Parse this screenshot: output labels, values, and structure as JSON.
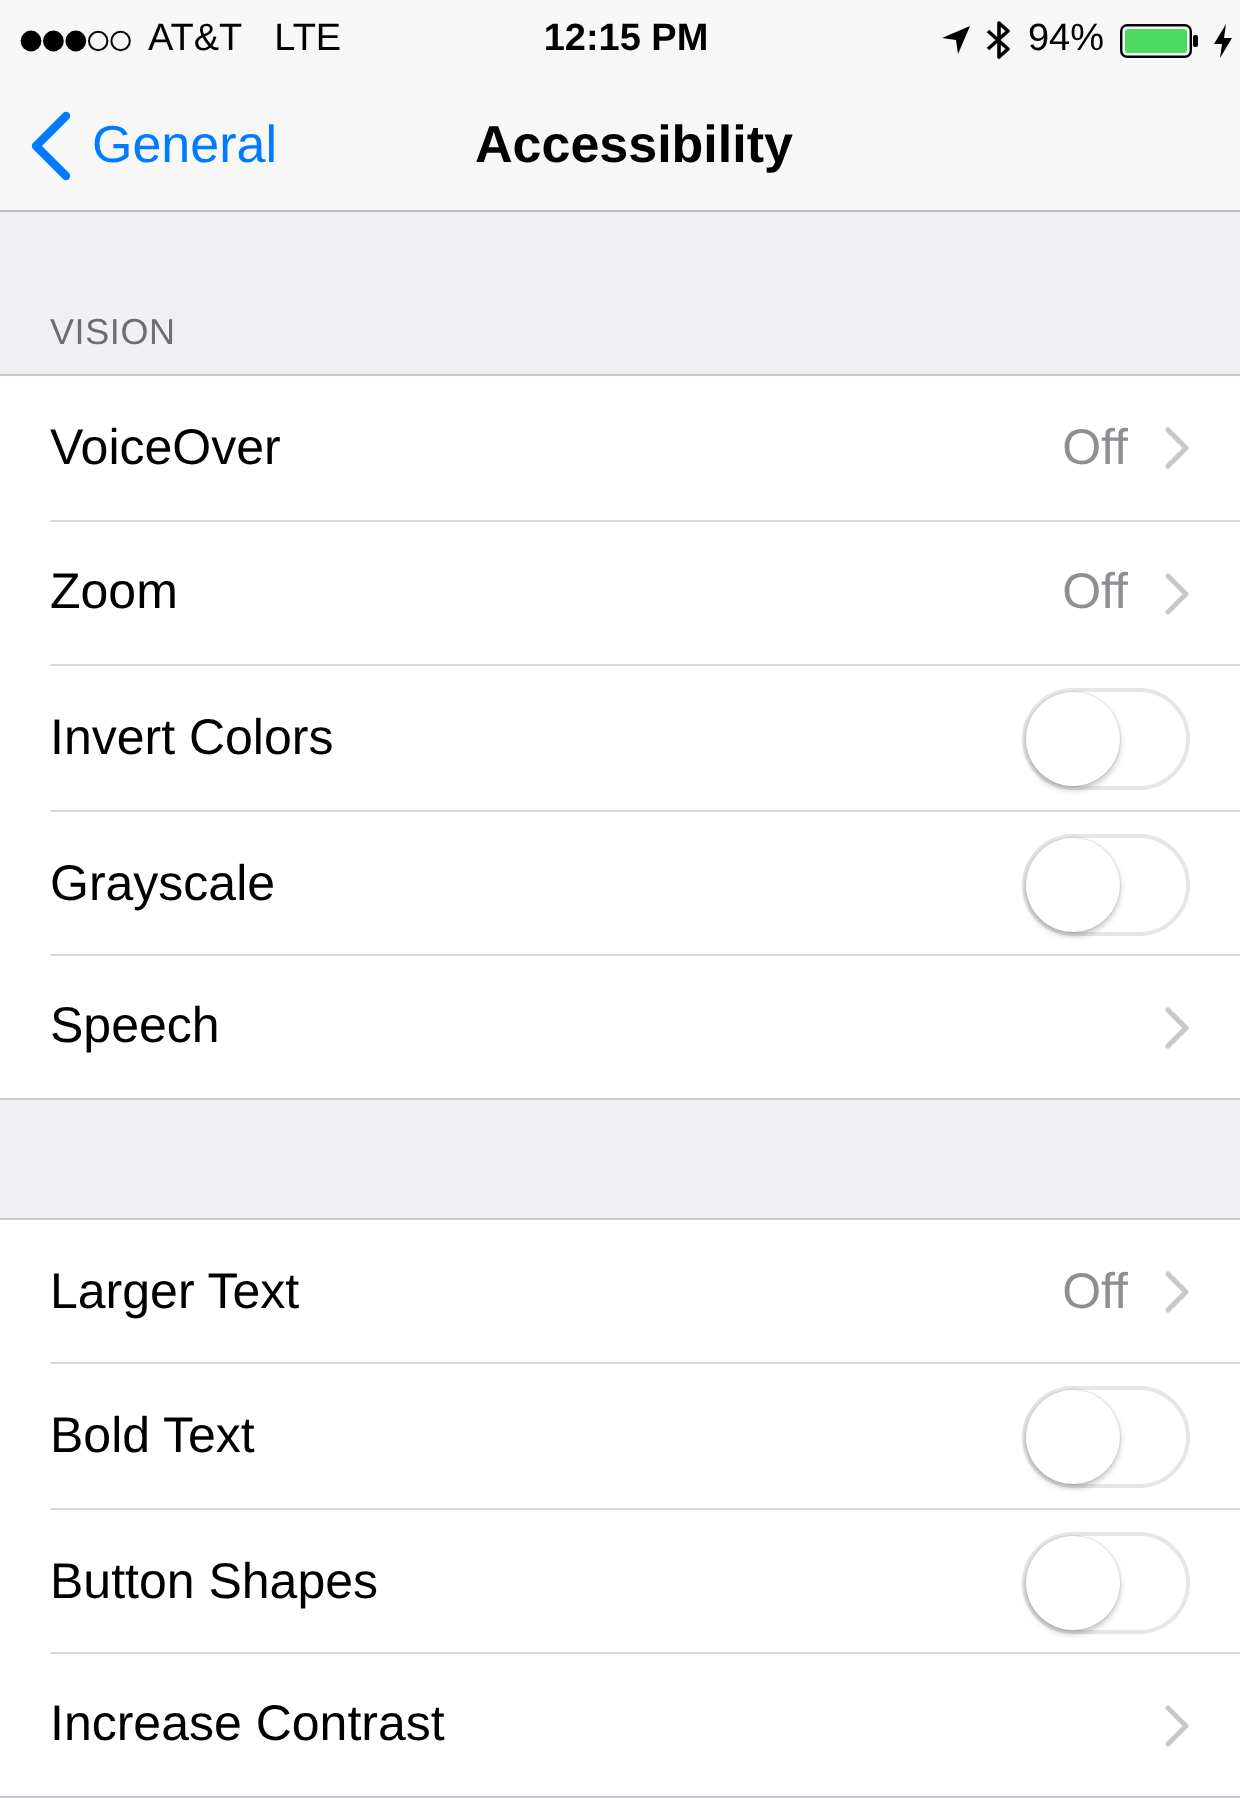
{
  "status_bar": {
    "carrier": "AT&T",
    "network": "LTE",
    "time": "12:15 PM",
    "battery_percent": "94%",
    "charging": true
  },
  "nav_bar": {
    "back_label": "General",
    "title": "Accessibility"
  },
  "sections": [
    {
      "header": "VISION",
      "rows": [
        {
          "kind": "link",
          "label": "VoiceOver",
          "value": "Off"
        },
        {
          "kind": "link",
          "label": "Zoom",
          "value": "Off"
        },
        {
          "kind": "toggle",
          "label": "Invert Colors",
          "on": false
        },
        {
          "kind": "toggle",
          "label": "Grayscale",
          "on": false
        },
        {
          "kind": "link",
          "label": "Speech"
        }
      ]
    },
    {
      "rows": [
        {
          "kind": "link",
          "label": "Larger Text",
          "value": "Off"
        },
        {
          "kind": "toggle",
          "label": "Bold Text",
          "on": false
        },
        {
          "kind": "toggle",
          "label": "Button Shapes",
          "on": false
        },
        {
          "kind": "link",
          "label": "Increase Contrast"
        }
      ]
    }
  ]
}
